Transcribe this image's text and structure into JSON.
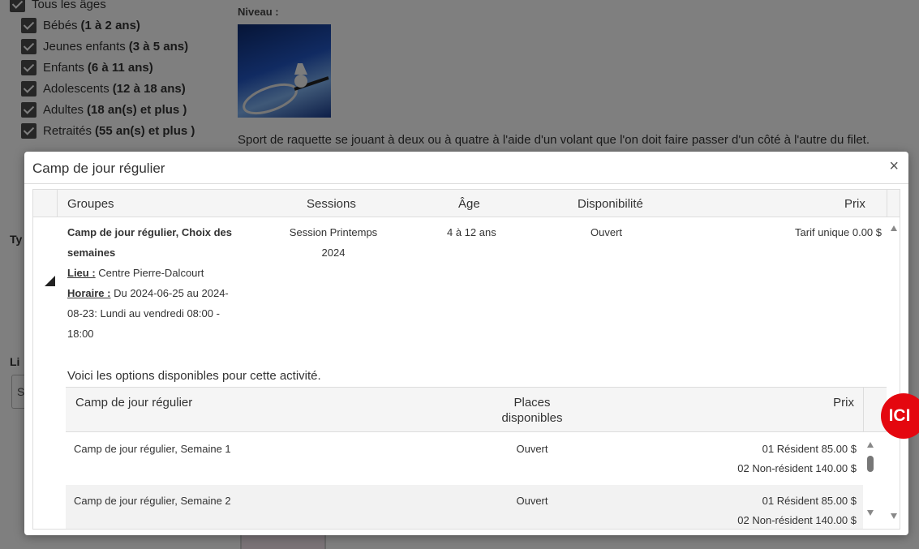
{
  "background": {
    "ages": [
      {
        "label": "Tous les âges",
        "bold": ""
      },
      {
        "label": "Bébés",
        "bold": "(1 à 2 ans)"
      },
      {
        "label": "Jeunes enfants",
        "bold": "(3 à 5 ans)"
      },
      {
        "label": "Enfants",
        "bold": "(6 à 11 ans)"
      },
      {
        "label": "Adolescents",
        "bold": "(12 à 18 ans)"
      },
      {
        "label": "Adultes",
        "bold": "(18 an(s) et plus )"
      },
      {
        "label": "Retraités",
        "bold": "(55 an(s) et plus )"
      }
    ],
    "niveau_label": "Niveau :",
    "description": "Sport de raquette se jouant à deux ou à quatre à l'aide d'un volant que l'on doit faire passer d'un côté à l'autre du filet.",
    "frag_ty": "Ty",
    "frag_li": "Li",
    "frag_s": "S"
  },
  "dialog": {
    "title": "Camp de jour régulier",
    "close_icon": "×",
    "columns": {
      "groupes": "Groupes",
      "sessions": "Sessions",
      "age": "Âge",
      "dispo": "Disponibilité",
      "prix": "Prix"
    },
    "row": {
      "group_name_line1": "Camp de jour régulier, Choix des",
      "group_name_line2": "semaines",
      "lieu_label": "Lieu :",
      "lieu_value": "Centre Pierre-Dalcourt",
      "horaire_label": "Horaire :",
      "horaire_line1": "Du 2024-06-25 au 2024-",
      "horaire_line2": "08-23: Lundi au vendredi 08:00 -",
      "horaire_line3": "18:00",
      "session_line1": "Session Printemps",
      "session_line2": "2024",
      "age": "4 à 12 ans",
      "dispo": "Ouvert",
      "prix": "Tarif unique 0.00 $"
    },
    "options_label": "Voici les options disponibles pour cette activité.",
    "options_columns": {
      "name": "Camp de jour régulier",
      "places_line1": "Places",
      "places_line2": "disponibles",
      "prix": "Prix"
    },
    "options": [
      {
        "name": "Camp de jour régulier, Semaine 1",
        "places": "Ouvert",
        "price1": "01 Résident 85.00 $",
        "price2": "02 Non-résident 140.00 $"
      },
      {
        "name": "Camp de jour régulier, Semaine 2",
        "places": "Ouvert",
        "price1": "01 Résident 85.00 $",
        "price2": "02 Non-résident 140.00 $"
      }
    ]
  },
  "badge": {
    "label": "ICI",
    "color": "#e4070f"
  }
}
